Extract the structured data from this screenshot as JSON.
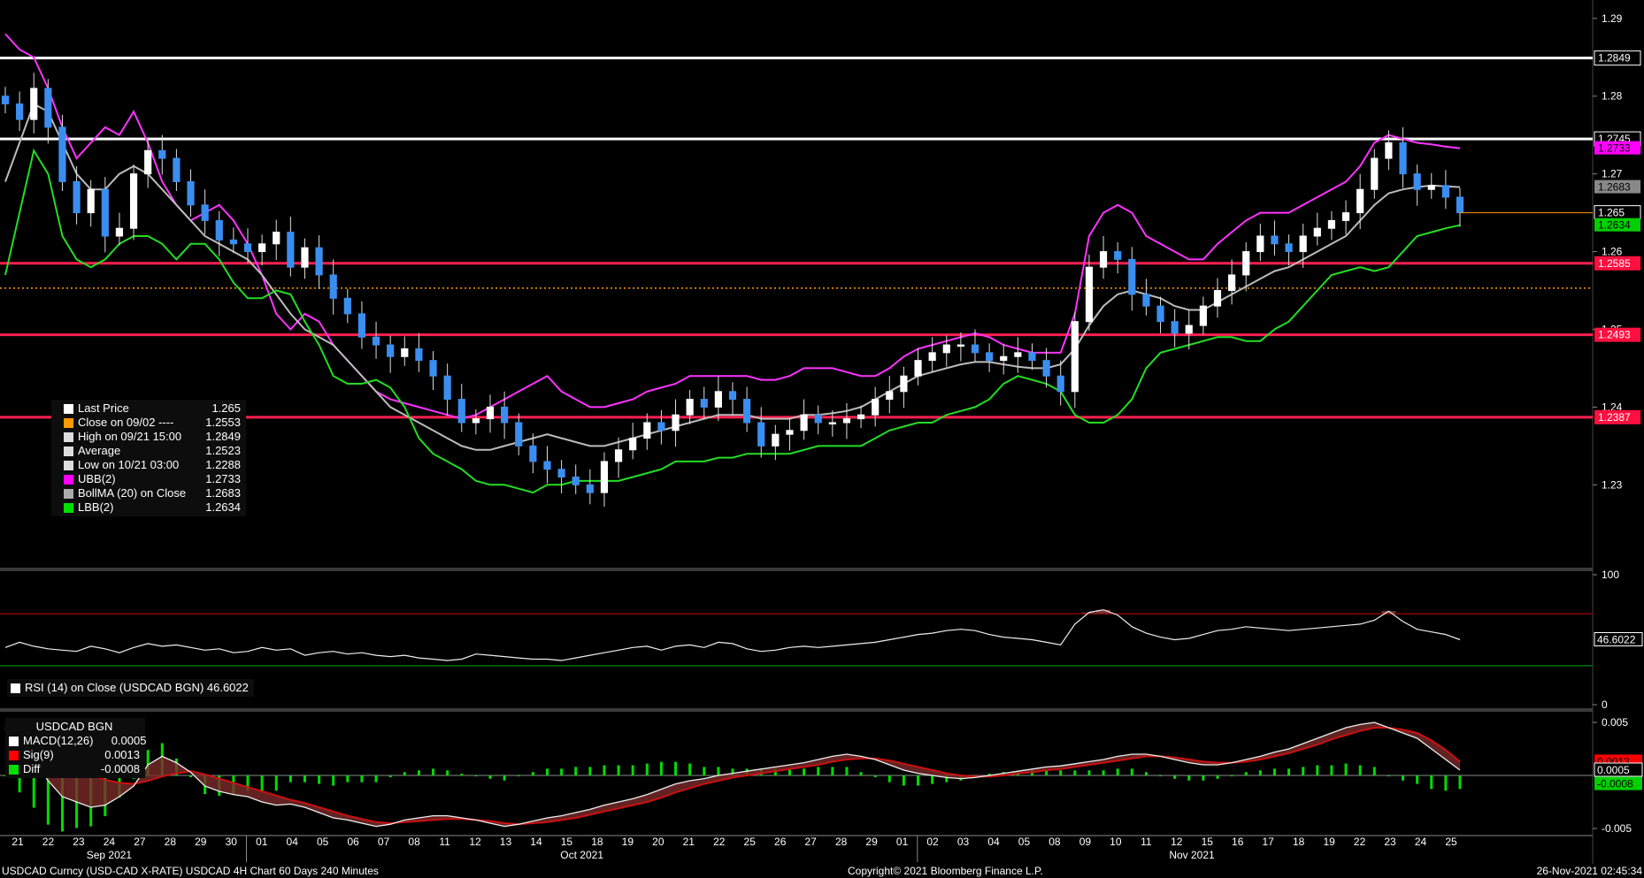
{
  "footer": {
    "left": "USDCAD Curncy (USD-CAD X-RATE) USDCAD 4H Chart 60 Days 240 Minutes",
    "center": "Copyright© 2021 Bloomberg Finance L.P.",
    "right": "26-Nov-2021 02:45:34"
  },
  "legend_main": {
    "rows": [
      {
        "label": "Last Price",
        "value": "1.265",
        "color": "#ffffff"
      },
      {
        "label": "Close on 09/02 ----",
        "value": "1.2553",
        "color": "#ff9900"
      },
      {
        "label": "High on 09/21 15:00",
        "value": "1.2849",
        "color": "#dddddd"
      },
      {
        "label": "Average",
        "value": "1.2523",
        "color": "#dddddd"
      },
      {
        "label": "Low on 10/21 03:00",
        "value": "1.2288",
        "color": "#dddddd"
      },
      {
        "label": "UBB(2)",
        "value": "1.2733",
        "color": "#ff00ff"
      },
      {
        "label": "BollMA (20)  on Close",
        "value": "1.2683",
        "color": "#aaaaaa"
      },
      {
        "label": "LBB(2)",
        "value": "1.2634",
        "color": "#00e000"
      }
    ]
  },
  "legend_rsi": {
    "label": "RSI (14)  on Close (USDCAD BGN) 46.6022"
  },
  "legend_macd": {
    "title": "USDCAD BGN",
    "rows": [
      {
        "label": "MACD(12,26)",
        "value": "0.0005",
        "color": "#ffffff"
      },
      {
        "label": "Sig(9)",
        "value": "0.0013",
        "color": "#ff0000"
      },
      {
        "label": "Diff",
        "value": "-0.0008",
        "color": "#00e000"
      }
    ]
  },
  "chart_data": {
    "type": "candlestick",
    "x_ticks": [
      "21",
      "22",
      "23",
      "24",
      "27",
      "28",
      "29",
      "30",
      "01",
      "04",
      "05",
      "06",
      "07",
      "08",
      "11",
      "12",
      "13",
      "14",
      "15",
      "18",
      "19",
      "20",
      "21",
      "22",
      "25",
      "26",
      "27",
      "28",
      "29",
      "01",
      "02",
      "03",
      "04",
      "05",
      "08",
      "09",
      "10",
      "11",
      "12",
      "15",
      "16",
      "17",
      "18",
      "19",
      "22",
      "23",
      "24",
      "25"
    ],
    "month_labels": [
      {
        "label": "Sep 2021",
        "at": 3
      },
      {
        "label": "Oct 2021",
        "at": 18.5
      },
      {
        "label": "Nov 2021",
        "at": 38.5
      }
    ],
    "price_axis": {
      "ylim": [
        1.2198,
        1.2918
      ],
      "ticks": [
        "1.29",
        "1.28",
        "1.27",
        "1.26",
        "1.25",
        "1.24",
        "1.23"
      ]
    },
    "horizontal_lines": [
      {
        "value": 1.2849,
        "color": "#ffffff",
        "label": "1.2849"
      },
      {
        "value": 1.2745,
        "color": "#ffffff",
        "label": "1.2745"
      },
      {
        "value": 1.2585,
        "color": "#ff2050",
        "label": "1.2585"
      },
      {
        "value": 1.2493,
        "color": "#ff2050",
        "label": "1.2493"
      },
      {
        "value": 1.2387,
        "color": "#ff2050",
        "label": "1.2387"
      }
    ],
    "reference_line": {
      "value": 1.2553,
      "color": "#ff9900"
    },
    "axis_markers": [
      {
        "label": "1.2733",
        "value": 1.2733,
        "bg": "#ff00ff"
      },
      {
        "label": "1.2683",
        "value": 1.2683,
        "bg": "#888888"
      },
      {
        "label": "1.265",
        "value": 1.265,
        "bg": "#000000"
      },
      {
        "label": "1.2634",
        "value": 1.2634,
        "bg": "#00d000"
      }
    ],
    "close": [
      1.279,
      1.277,
      1.281,
      1.276,
      1.269,
      1.265,
      1.268,
      1.262,
      1.263,
      1.27,
      1.273,
      1.272,
      1.269,
      1.266,
      1.264,
      1.2615,
      1.261,
      1.26,
      1.261,
      1.2625,
      1.258,
      1.2605,
      1.257,
      1.254,
      1.252,
      1.249,
      1.248,
      1.2465,
      1.2475,
      1.246,
      1.244,
      1.241,
      1.238,
      1.2385,
      1.24,
      1.238,
      1.235,
      1.233,
      1.232,
      1.231,
      1.23,
      1.229,
      1.233,
      1.2345,
      1.236,
      1.238,
      1.237,
      1.239,
      1.241,
      1.24,
      1.242,
      1.241,
      1.238,
      1.235,
      1.2365,
      1.237,
      1.239,
      1.238,
      1.238,
      1.2385,
      1.239,
      1.241,
      1.242,
      1.244,
      1.246,
      1.247,
      1.248,
      1.248,
      1.247,
      1.246,
      1.2465,
      1.247,
      1.246,
      1.244,
      1.242,
      1.251,
      1.258,
      1.26,
      1.259,
      1.2545,
      1.253,
      1.251,
      1.2495,
      1.2505,
      1.253,
      1.255,
      1.257,
      1.26,
      1.262,
      1.261,
      1.26,
      1.262,
      1.263,
      1.264,
      1.265,
      1.268,
      1.272,
      1.274,
      1.27,
      1.268,
      1.2685,
      1.267,
      1.265
    ],
    "ubb": [
      1.288,
      1.286,
      1.285,
      1.281,
      1.276,
      1.272,
      1.274,
      1.276,
      1.275,
      1.278,
      1.274,
      1.269,
      1.266,
      1.264,
      1.265,
      1.266,
      1.264,
      1.261,
      1.257,
      1.252,
      1.25,
      1.252,
      1.251,
      1.248,
      1.246,
      1.244,
      1.242,
      1.241,
      1.2405,
      1.24,
      1.2395,
      1.239,
      1.2385,
      1.239,
      1.24,
      1.241,
      1.242,
      1.243,
      1.244,
      1.242,
      1.241,
      1.24,
      1.24,
      1.2405,
      1.241,
      1.242,
      1.2425,
      1.243,
      1.244,
      1.244,
      1.244,
      1.244,
      1.244,
      1.2435,
      1.2435,
      1.244,
      1.245,
      1.245,
      1.245,
      1.2445,
      1.244,
      1.244,
      1.245,
      1.2465,
      1.2475,
      1.248,
      1.2485,
      1.249,
      1.2495,
      1.249,
      1.248,
      1.2475,
      1.247,
      1.247,
      1.247,
      1.252,
      1.262,
      1.265,
      1.266,
      1.265,
      1.262,
      1.261,
      1.26,
      1.259,
      1.259,
      1.261,
      1.2625,
      1.264,
      1.265,
      1.265,
      1.265,
      1.266,
      1.267,
      1.268,
      1.269,
      1.271,
      1.274,
      1.275,
      1.2745,
      1.274,
      1.2738,
      1.2735,
      1.2733
    ],
    "bollma": [
      1.269,
      1.274,
      1.279,
      1.278,
      1.274,
      1.27,
      1.268,
      1.268,
      1.27,
      1.271,
      1.27,
      1.268,
      1.266,
      1.264,
      1.262,
      1.261,
      1.26,
      1.259,
      1.257,
      1.2545,
      1.252,
      1.25,
      1.249,
      1.248,
      1.246,
      1.244,
      1.242,
      1.24,
      1.239,
      1.238,
      1.237,
      1.236,
      1.235,
      1.2345,
      1.2345,
      1.235,
      1.2355,
      1.236,
      1.2365,
      1.236,
      1.2355,
      1.235,
      1.235,
      1.2355,
      1.236,
      1.2365,
      1.237,
      1.2375,
      1.238,
      1.2385,
      1.239,
      1.239,
      1.239,
      1.2385,
      1.2385,
      1.2385,
      1.239,
      1.239,
      1.2392,
      1.2395,
      1.24,
      1.241,
      1.242,
      1.243,
      1.244,
      1.2445,
      1.245,
      1.2455,
      1.2458,
      1.2458,
      1.2455,
      1.2452,
      1.245,
      1.245,
      1.2455,
      1.2475,
      1.2505,
      1.253,
      1.2545,
      1.255,
      1.2545,
      1.254,
      1.253,
      1.2525,
      1.2525,
      1.2535,
      1.2545,
      1.2555,
      1.2565,
      1.2575,
      1.258,
      1.259,
      1.26,
      1.261,
      1.262,
      1.264,
      1.266,
      1.2675,
      1.268,
      1.2683,
      1.2685,
      1.2684,
      1.2683
    ],
    "lbb": [
      1.257,
      1.265,
      1.273,
      1.27,
      1.262,
      1.259,
      1.258,
      1.259,
      1.261,
      1.262,
      1.262,
      1.261,
      1.259,
      1.261,
      1.261,
      1.259,
      1.256,
      1.254,
      1.254,
      1.255,
      1.2545,
      1.251,
      1.248,
      1.244,
      1.243,
      1.243,
      1.2435,
      1.2425,
      1.24,
      1.236,
      1.234,
      1.233,
      1.232,
      1.2305,
      1.23,
      1.23,
      1.2295,
      1.229,
      1.23,
      1.23,
      1.2305,
      1.2305,
      1.2305,
      1.2305,
      1.231,
      1.2315,
      1.232,
      1.233,
      1.233,
      1.233,
      1.2335,
      1.2335,
      1.234,
      1.234,
      1.234,
      1.234,
      1.2345,
      1.235,
      1.235,
      1.235,
      1.235,
      1.236,
      1.237,
      1.2375,
      1.238,
      1.238,
      1.239,
      1.2395,
      1.24,
      1.241,
      1.243,
      1.244,
      1.2435,
      1.243,
      1.242,
      1.239,
      1.238,
      1.238,
      1.239,
      1.241,
      1.245,
      1.247,
      1.2475,
      1.248,
      1.2485,
      1.249,
      1.249,
      1.2485,
      1.2485,
      1.25,
      1.251,
      1.253,
      1.255,
      1.257,
      1.2575,
      1.258,
      1.2575,
      1.258,
      1.26,
      1.262,
      1.2625,
      1.263,
      1.2634
    ],
    "rsi": {
      "ylim": [
        0,
        100
      ],
      "ticks": [
        "100",
        "0"
      ],
      "upper": 70,
      "lower": 30,
      "marker": "46.6022",
      "values": [
        44,
        48,
        45,
        43,
        42,
        41,
        45,
        43,
        40,
        44,
        47,
        45,
        46,
        44,
        42,
        43,
        40,
        41,
        44,
        42,
        43,
        38,
        40,
        41,
        39,
        40,
        38,
        37,
        38,
        36,
        35,
        34,
        35,
        39,
        38,
        37,
        36,
        35,
        35,
        34,
        36,
        38,
        40,
        42,
        44,
        45,
        42,
        45,
        46,
        44,
        48,
        47,
        43,
        41,
        42,
        44,
        45,
        44,
        45,
        46,
        47,
        48,
        50,
        52,
        54,
        55,
        57,
        58,
        57,
        54,
        52,
        51,
        50,
        48,
        46,
        62,
        71,
        73,
        69,
        60,
        55,
        52,
        50,
        51,
        54,
        57,
        58,
        60,
        59,
        58,
        57,
        58,
        59,
        60,
        61,
        62,
        65,
        72,
        64,
        58,
        56,
        54,
        50
      ]
    },
    "macd": {
      "ylim": [
        -0.0055,
        0.006
      ],
      "ticks": [
        "0.005",
        "-0.005"
      ],
      "markers": [
        {
          "label": "0.0013",
          "value": 0.0013,
          "bg": "#ff0000"
        },
        {
          "label": "0.0005",
          "value": 0.0005,
          "bg": "#000000"
        },
        {
          "label": "-0.0008",
          "value": -0.0008,
          "bg": "#00d000"
        }
      ],
      "macd": [
        0.0045,
        0.003,
        0.0015,
        -0.0005,
        -0.002,
        -0.0025,
        -0.003,
        -0.0028,
        -0.002,
        -0.001,
        0.001,
        0.0018,
        0.0012,
        0.0003,
        -0.001,
        -0.0015,
        -0.0018,
        -0.002,
        -0.0025,
        -0.0028,
        -0.0027,
        -0.003,
        -0.0035,
        -0.004,
        -0.0042,
        -0.0045,
        -0.0048,
        -0.0046,
        -0.0042,
        -0.004,
        -0.0038,
        -0.0038,
        -0.004,
        -0.0042,
        -0.0045,
        -0.0048,
        -0.0046,
        -0.0043,
        -0.004,
        -0.0038,
        -0.0035,
        -0.0032,
        -0.0028,
        -0.0025,
        -0.0022,
        -0.0018,
        -0.0013,
        -0.0008,
        -0.0005,
        -0.0003,
        0.0,
        0.0002,
        0.0004,
        0.0006,
        0.0008,
        0.001,
        0.0012,
        0.0015,
        0.0018,
        0.002,
        0.0018,
        0.0015,
        0.001,
        0.0005,
        0.0002,
        0.0,
        -0.0002,
        -0.0003,
        -0.0002,
        0.0,
        0.0002,
        0.0004,
        0.0006,
        0.0008,
        0.0009,
        0.0011,
        0.0013,
        0.0015,
        0.0018,
        0.002,
        0.002,
        0.0018,
        0.0015,
        0.0012,
        0.001,
        0.001,
        0.0012,
        0.0015,
        0.0018,
        0.0022,
        0.0025,
        0.003,
        0.0035,
        0.004,
        0.0045,
        0.0048,
        0.005,
        0.0045,
        0.004,
        0.0035,
        0.0025,
        0.0015,
        0.0005
      ],
      "signal": [
        0.0045,
        0.004,
        0.0034,
        0.0024,
        0.0013,
        0.0006,
        0.0,
        -0.0004,
        -0.0007,
        -0.0008,
        -0.0005,
        -0.0001,
        0.0002,
        0.0004,
        0.0001,
        -0.0003,
        -0.0007,
        -0.0011,
        -0.0015,
        -0.0019,
        -0.0023,
        -0.0026,
        -0.003,
        -0.0034,
        -0.0038,
        -0.0041,
        -0.0044,
        -0.0045,
        -0.0044,
        -0.0043,
        -0.0042,
        -0.0041,
        -0.0041,
        -0.0042,
        -0.0043,
        -0.0045,
        -0.0046,
        -0.0045,
        -0.0044,
        -0.0042,
        -0.004,
        -0.0037,
        -0.0034,
        -0.0031,
        -0.0028,
        -0.0025,
        -0.0021,
        -0.0016,
        -0.0012,
        -0.0008,
        -0.0005,
        -0.0002,
        0.0,
        0.0002,
        0.0004,
        0.0006,
        0.0008,
        0.001,
        0.0013,
        0.0015,
        0.0016,
        0.0016,
        0.0014,
        0.0011,
        0.0008,
        0.0005,
        0.0002,
        0.0,
        -0.0001,
        -0.0001,
        0.0,
        0.0002,
        0.0003,
        0.0005,
        0.0006,
        0.0008,
        0.001,
        0.0012,
        0.0014,
        0.0016,
        0.0018,
        0.0018,
        0.0017,
        0.0015,
        0.0013,
        0.0012,
        0.0012,
        0.0013,
        0.0015,
        0.0018,
        0.0021,
        0.0025,
        0.0029,
        0.0034,
        0.0038,
        0.0042,
        0.0045,
        0.0045,
        0.0043,
        0.004,
        0.0033,
        0.0024,
        0.0013
      ]
    }
  }
}
